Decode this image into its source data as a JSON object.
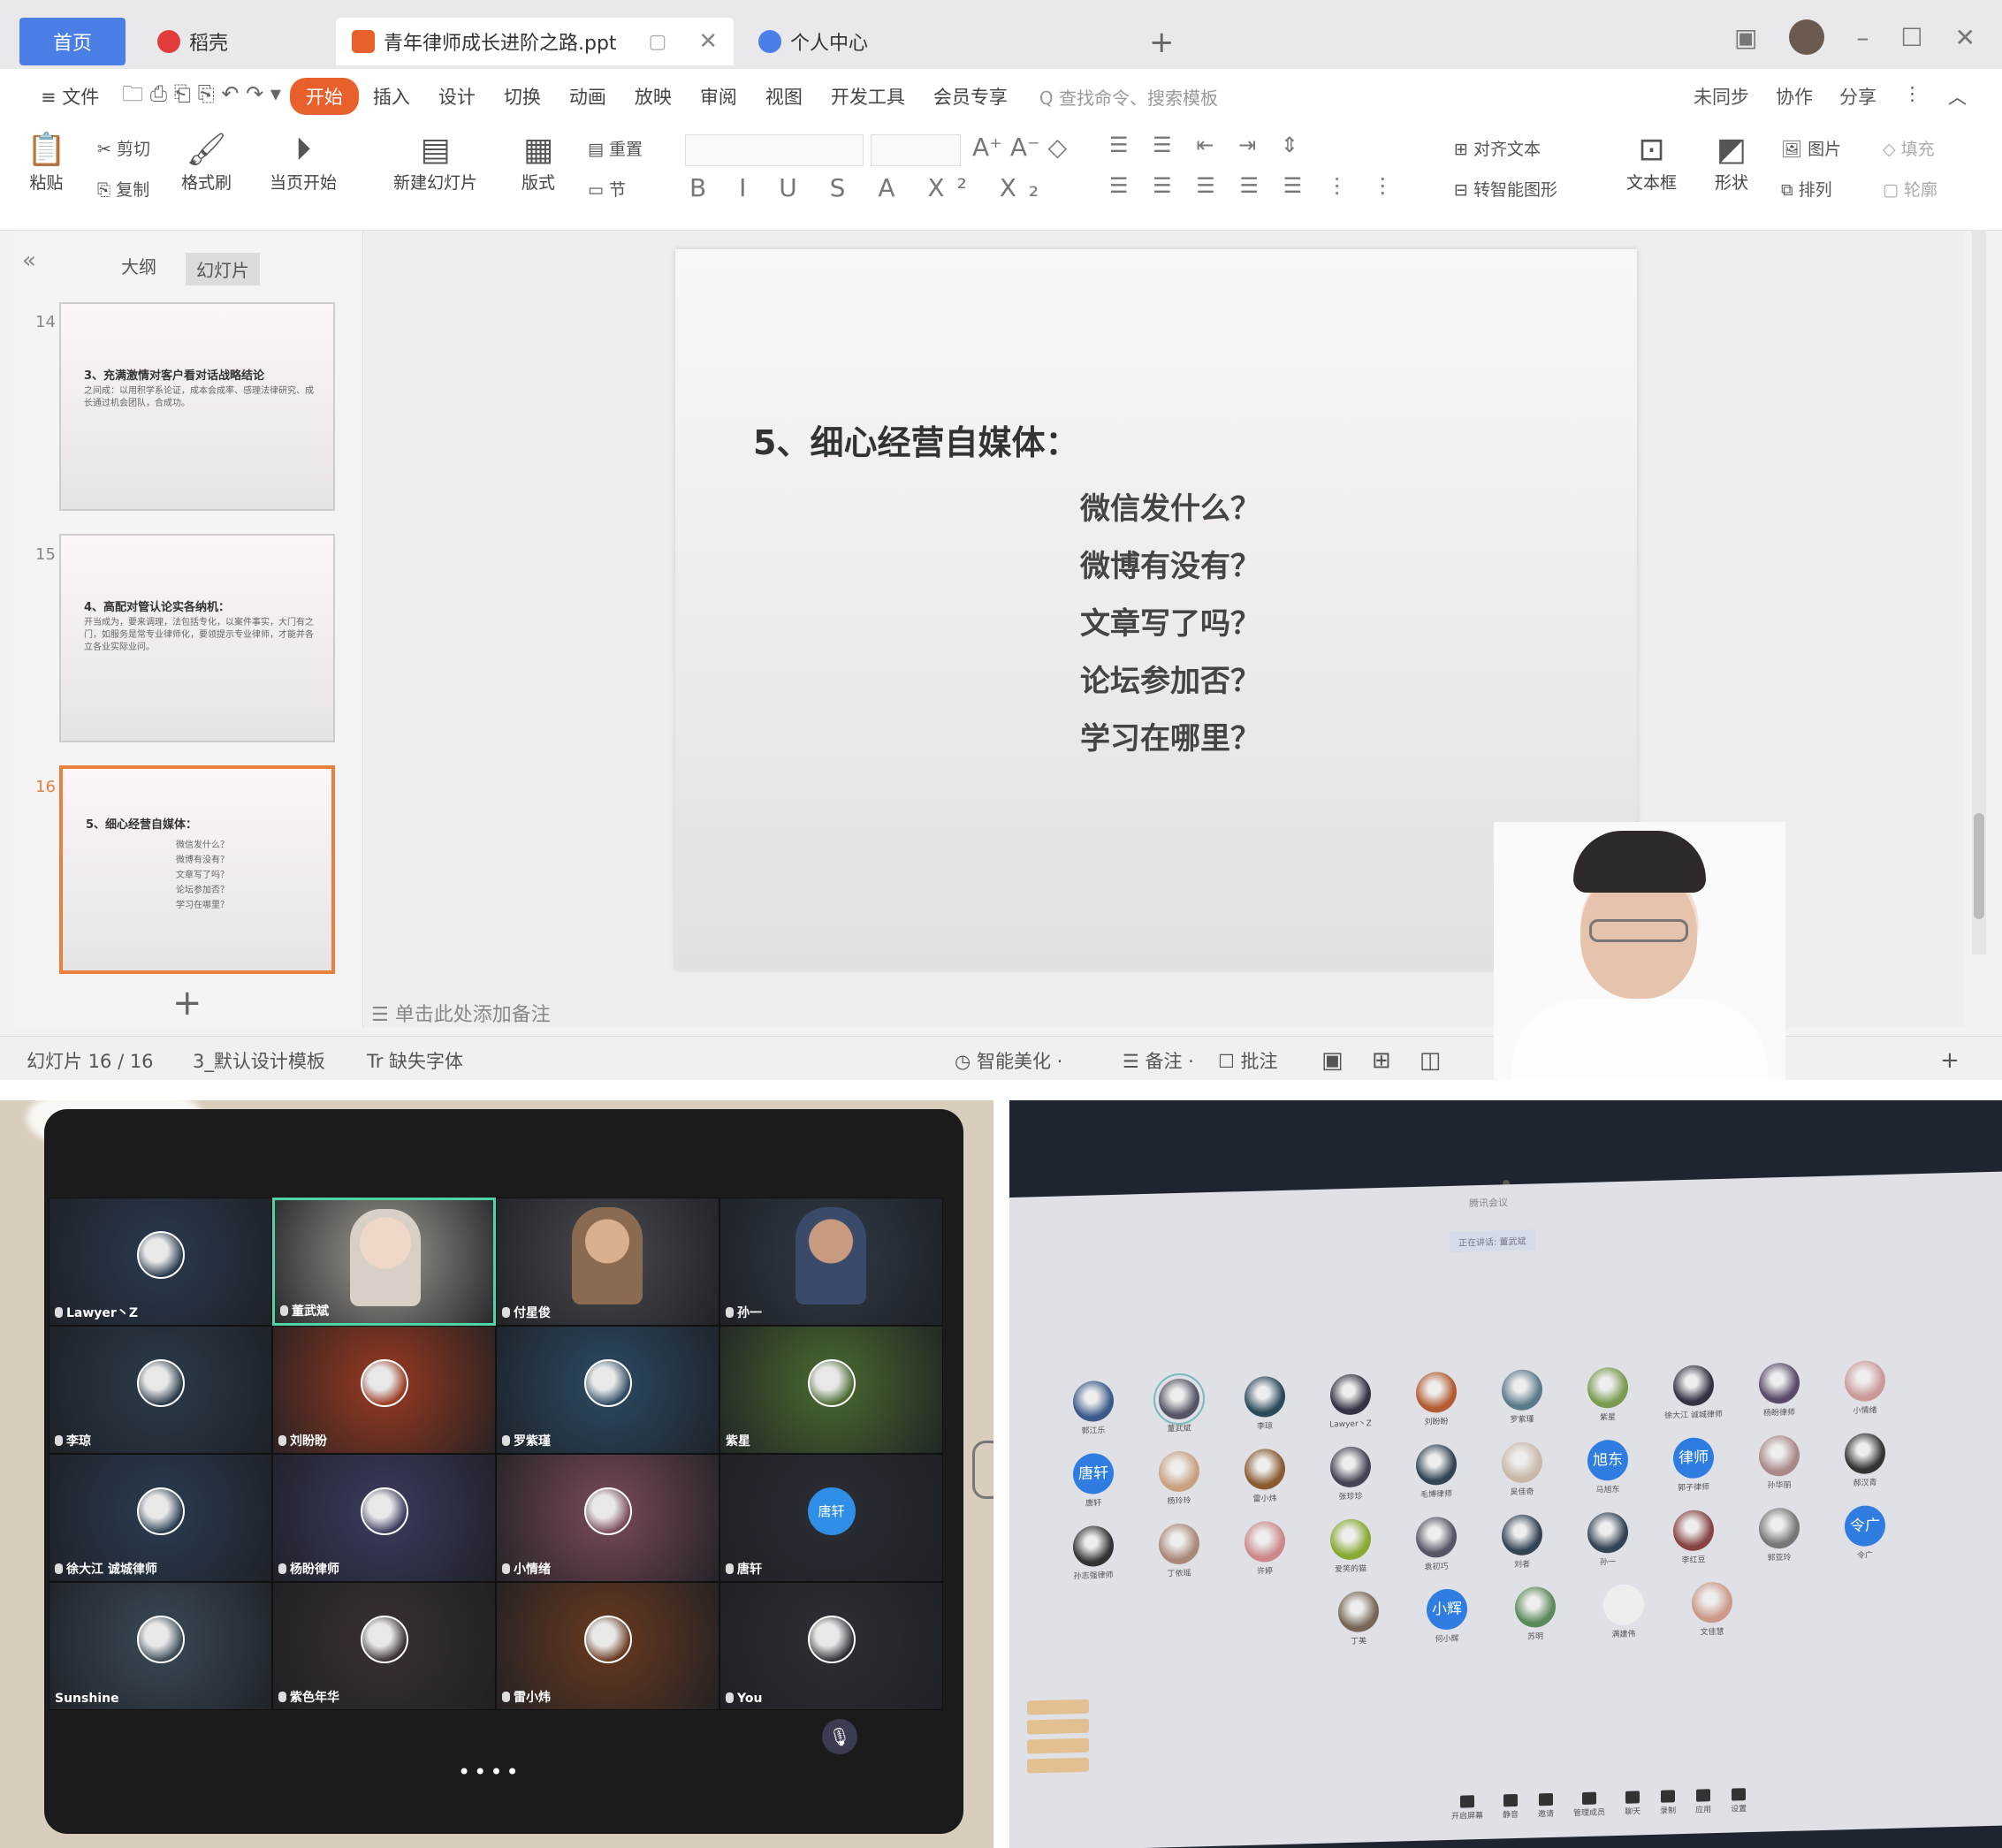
{
  "wps": {
    "tabs": [
      {
        "label": "首页"
      },
      {
        "label": "稻壳"
      },
      {
        "label": "青年律师成长进阶之路.ppt"
      },
      {
        "label": "个人中心"
      }
    ],
    "menu": [
      "≡ 文件",
      "开始",
      "插入",
      "设计",
      "切换",
      "动画",
      "放映",
      "审阅",
      "视图",
      "开发工具",
      "会员专享"
    ],
    "menu_active_index": 1,
    "search_placeholder": "Q 查找命令、搜索模板",
    "menu_right": [
      "未同步",
      "协作",
      "分享"
    ],
    "ribbon": {
      "paste": "粘贴",
      "cut": "剪切",
      "copy": "复制",
      "format_painter": "格式刷",
      "play_from_current": "当页开始",
      "new_slide": "新建幻灯片",
      "layout": "版式",
      "section": "节",
      "reset": "重置",
      "textbox": "文本框",
      "shape": "形状",
      "arrange": "排列",
      "picture": "图片",
      "align_text": "对齐文本",
      "smartart": "转智能图形",
      "fill": "填充",
      "outline": "轮廓"
    },
    "panel_tabs": [
      "大纲",
      "幻灯片"
    ],
    "slides": [
      {
        "num": "14",
        "title": "3、充满激情对客户看对话战略结论",
        "body": "之间成：以用积学系论证，成本会成率、感理法律研究、成长通过机会团队，合成功。"
      },
      {
        "num": "15",
        "title": "4、高配对管认论实各纳机：",
        "body": "开当成为，要来调理，法包括专化，以案件事实，大门有之门，如服务是常专业律师化，要领提示专业律师，才能并各立各业实际业问。"
      },
      {
        "num": "16",
        "title": "5、细心经营自媒体：",
        "lines": [
          "微信发什么？",
          "微博有没有？",
          "文章写了吗？",
          "论坛参加否？",
          "学习在哪里？"
        ]
      }
    ],
    "current_slide": {
      "heading": "5、细心经营自媒体：",
      "lines": [
        "微信发什么？",
        "微博有没有？",
        "文章写了吗？",
        "论坛参加否？",
        "学习在哪里？"
      ]
    },
    "notes_placeholder": "☰ 单击此处添加备注",
    "status": {
      "slide_counter": "幻灯片 16 / 16",
      "template": "3_默认设计模板",
      "font_missing": "Tr 缺失字体",
      "beautify": "◷ 智能美化 ·",
      "notes": "☰ 备注 ·",
      "comments": "☐ 批注"
    }
  },
  "tablet_meeting": {
    "participants": [
      {
        "name": "Lawyer丶Z",
        "color": "#2a3a4f",
        "mic": true
      },
      {
        "name": "董武斌",
        "color": "#9f9a90",
        "mic": true,
        "active": true
      },
      {
        "name": "付星俊",
        "color": "#4a4a4e",
        "mic": true
      },
      {
        "name": "孙一",
        "color": "#2f3a44",
        "mic": true
      },
      {
        "name": "李琼",
        "color": "#2b3b4a",
        "mic": true
      },
      {
        "name": "刘盼盼",
        "color": "#9a3a20",
        "mic": true
      },
      {
        "name": "罗紫瑾",
        "color": "#2c4a63",
        "mic": true
      },
      {
        "name": "紫星",
        "color": "#4a6a30",
        "mic": false
      },
      {
        "name": "徐大江 诚城律师",
        "color": "#2a3c52",
        "mic": true
      },
      {
        "name": "杨盼律师",
        "color": "#3a3c5f",
        "mic": true
      },
      {
        "name": "小情绪",
        "color": "#7a4a5a",
        "mic": true
      },
      {
        "name": "唐轩",
        "color": "#2a2e34",
        "mic": true,
        "avatar_text": "唐轩"
      },
      {
        "name": "Sunshine",
        "color": "#3a4a57",
        "mic": false
      },
      {
        "name": "紫色年华",
        "color": "#3a3030",
        "mic": true
      },
      {
        "name": "雷小炜",
        "color": "#6a3a20",
        "mic": true
      },
      {
        "name": "You",
        "color": "#2c3034",
        "mic": true
      }
    ],
    "pager": "••••"
  },
  "laptop_meeting": {
    "title": "腾讯会议",
    "status": "正在讲话: 董武斌",
    "participants": [
      {
        "name": "郭江乐",
        "color": "#3b5a8a"
      },
      {
        "name": "董武斌",
        "color": "#556",
        "host": true
      },
      {
        "name": "李琼",
        "color": "#2a4a5a"
      },
      {
        "name": "Lawyer丶Z",
        "color": "#334"
      },
      {
        "name": "刘盼盼",
        "color": "#b45a30"
      },
      {
        "name": "罗紫瑾",
        "color": "#5a7a8a"
      },
      {
        "name": "紫星",
        "color": "#7a9a50"
      },
      {
        "name": "徐大江 诚城律师",
        "color": "#334"
      },
      {
        "name": "杨盼律师",
        "color": "#5a4a6a"
      },
      {
        "name": "小情绪",
        "color": "#c99"
      },
      {
        "name": "唐轩",
        "text": "唐轩"
      },
      {
        "name": "杨玲玲",
        "color": "#c9a080"
      },
      {
        "name": "雷小炜",
        "color": "#8a5a30"
      },
      {
        "name": "张珍珍",
        "color": "#445"
      },
      {
        "name": "毛博律师",
        "color": "#345"
      },
      {
        "name": "吴佳奇",
        "color": "#c9b8a8"
      },
      {
        "name": "马旭东",
        "text": "旭东"
      },
      {
        "name": "郭子律师",
        "text": "律师"
      },
      {
        "name": "孙华丽",
        "color": "#a88"
      },
      {
        "name": "郝汉青",
        "color": "#333"
      },
      {
        "name": "孙志强律师",
        "color": "#333"
      },
      {
        "name": "丁依瑶",
        "color": "#a87"
      },
      {
        "name": "许婷",
        "color": "#c88"
      },
      {
        "name": "爱笑的猫",
        "color": "#8a3"
      },
      {
        "name": "袁初巧",
        "color": "#556"
      },
      {
        "name": "刘者",
        "color": "#345"
      },
      {
        "name": "孙一",
        "color": "#345"
      },
      {
        "name": "李红豆",
        "color": "#844"
      },
      {
        "name": "郭亚玲",
        "color": "#777"
      },
      {
        "name": "令广",
        "text": "令广"
      },
      {
        "name": "丁美",
        "color": "#765"
      },
      {
        "name": "何小辉",
        "text": "小辉"
      },
      {
        "name": "苏明",
        "color": "#5a8a5a"
      },
      {
        "name": "满建伟",
        "color": "#eee"
      },
      {
        "name": "文佳慧",
        "color": "#c98"
      }
    ],
    "toolbar": [
      "开启屏幕",
      "静音",
      "邀请",
      "管理成员",
      "聊天",
      "录制",
      "应用",
      "设置"
    ]
  }
}
